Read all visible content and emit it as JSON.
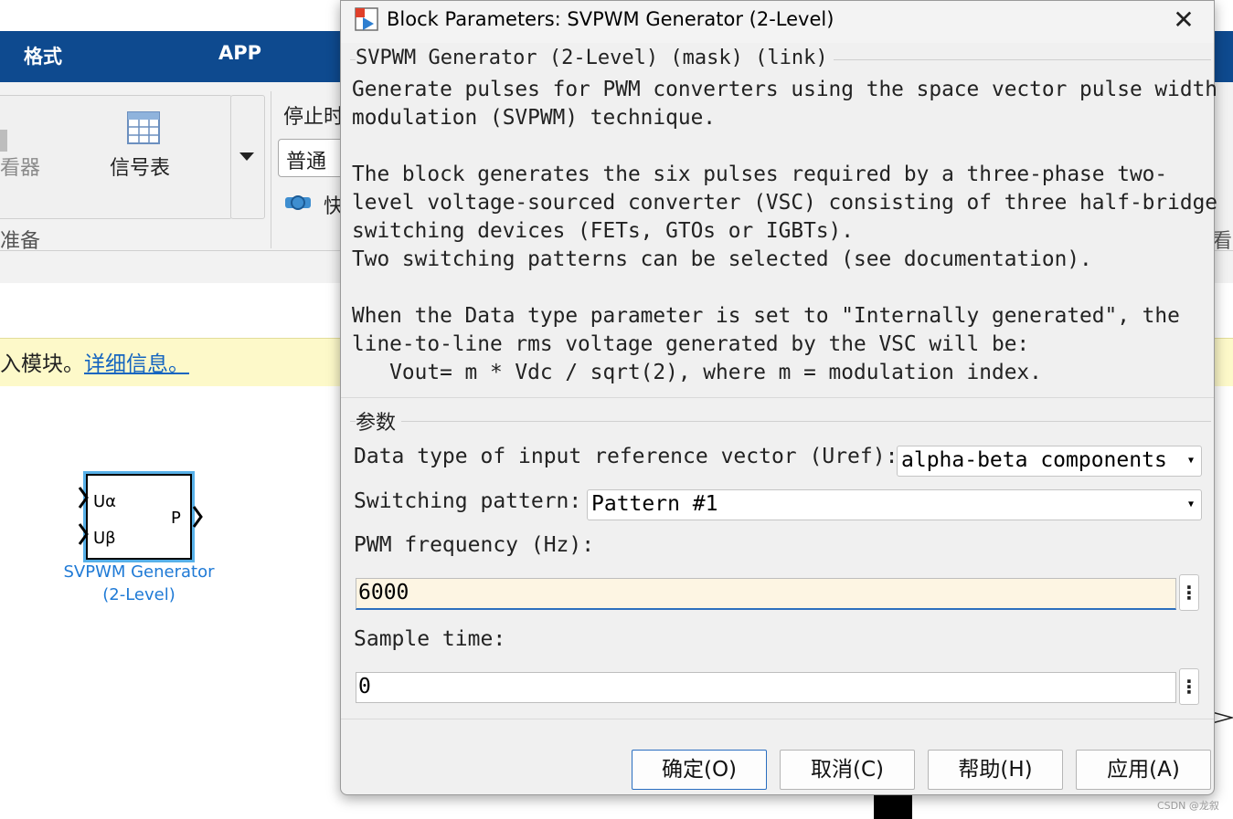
{
  "ribbon": {
    "tabs": [
      "格式",
      "APP"
    ],
    "viewer_label": "看器",
    "signal_table_label": "信号表",
    "stop_time_label": "停止时",
    "mode_value": "普通",
    "fast_label": "快",
    "prepare_label": "准备",
    "right_clip_label": "看"
  },
  "infobar": {
    "text": "入模块。",
    "link": "详细信息。"
  },
  "block": {
    "port_in1": "Uα",
    "port_in2": "Uβ",
    "port_out": "P",
    "label_line1": "SVPWM Generator",
    "label_line2": "(2-Level)"
  },
  "dialog": {
    "title": "Block Parameters: SVPWM Generator (2-Level)",
    "close_glyph": "✕",
    "group_title": "SVPWM Generator (2-Level) (mask) (link)",
    "description": [
      "Generate pulses for PWM converters using the space vector pulse width",
      "modulation (SVPWM) technique.",
      "",
      "The block generates the six pulses required by a three-phase two-",
      "level voltage-sourced converter (VSC) consisting of three half-bridge",
      "switching devices (FETs, GTOs or IGBTs).",
      "Two switching patterns can be selected (see documentation).",
      "",
      "When the Data type parameter is set to \"Internally generated\", the",
      "line-to-line rms voltage generated by the VSC will be:",
      "   Vout= m * Vdc / sqrt(2), where m = modulation index."
    ],
    "params_title": "参数",
    "params": {
      "data_type_label": "Data type of input reference vector (Uref):",
      "data_type_value": "alpha-beta components",
      "switching_label": "Switching pattern:",
      "switching_value": "Pattern #1",
      "pwm_freq_label": "PWM frequency (Hz):",
      "pwm_freq_value": "6000",
      "sample_time_label": "Sample time:",
      "sample_time_value": "0"
    },
    "buttons": {
      "ok": "确定(O)",
      "cancel": "取消(C)",
      "help": "帮助(H)",
      "apply": "应用(A)"
    }
  },
  "watermark": "CSDN @龙叙"
}
